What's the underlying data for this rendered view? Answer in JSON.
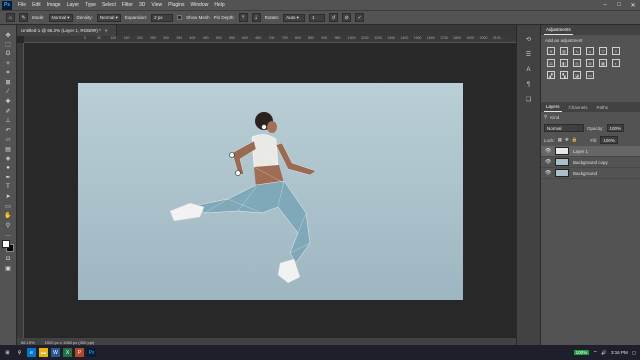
{
  "app": {
    "logo_text": "Ps"
  },
  "menu": [
    "File",
    "Edit",
    "Image",
    "Layer",
    "Type",
    "Select",
    "Filter",
    "3D",
    "View",
    "Plugins",
    "Window",
    "Help"
  ],
  "options": {
    "mode_label": "Mode:",
    "mode_value": "Normal",
    "density_label": "Density:",
    "density_value": "Normal",
    "expansion_label": "Expansion:",
    "expansion_value": "2 px",
    "show_mesh_label": "Show Mesh",
    "pin_depth_label": "Pin Depth:",
    "rotate_label": "Rotate:",
    "rotate_value": "Auto",
    "rotate_degrees": "1"
  },
  "document": {
    "tab_title": "Untitled-1 @ 66.2% (Layer 1, RGB/8#) *",
    "close": "×"
  },
  "ruler_ticks": [
    "0",
    "50",
    "100",
    "150",
    "200",
    "250",
    "300",
    "350",
    "400",
    "450",
    "500",
    "550",
    "600",
    "650",
    "700",
    "750",
    "800",
    "850",
    "900",
    "950",
    "1000",
    "1100",
    "1200",
    "1300",
    "1400",
    "1500",
    "1600",
    "1700",
    "1800",
    "1900",
    "2000",
    "2100"
  ],
  "status": {
    "zoom": "66.19%",
    "dimensions": "1920 px x 1080 px (300 ppi)"
  },
  "panels": {
    "adjustments_tab": "Adjustments",
    "add_adjustment": "Add an adjustment",
    "tabs": [
      "Layers",
      "Channels",
      "Paths"
    ],
    "blend_mode": "Normal",
    "opacity_label": "Opacity:",
    "opacity_value": "100%",
    "lock_label": "Lock:",
    "fill_label": "Fill:",
    "fill_value": "100%",
    "kind_label": "Kind"
  },
  "layers": [
    {
      "name": "Layer 1",
      "active": true
    },
    {
      "name": "Background copy",
      "active": false
    },
    {
      "name": "Background",
      "active": false
    }
  ],
  "taskbar": {
    "battery": "100%",
    "time": "3:16 PM"
  },
  "colors": {
    "accent": "#31a8ff",
    "workspace": "#282828",
    "panel": "#535353"
  }
}
